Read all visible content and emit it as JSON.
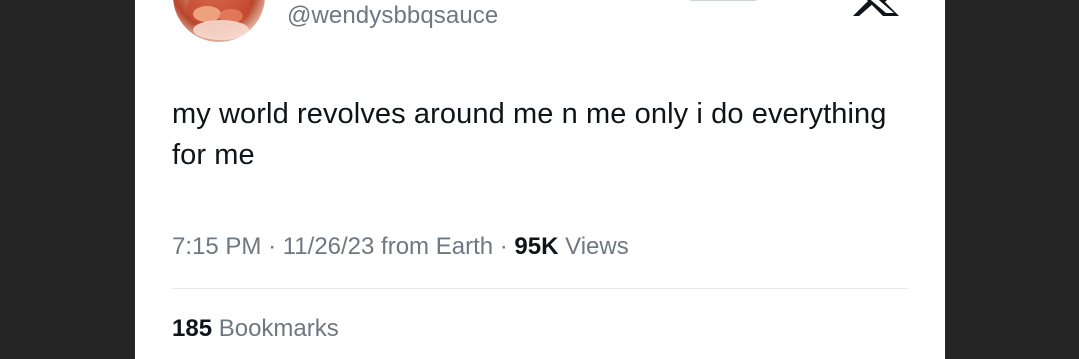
{
  "tweet": {
    "handle": "@wendysbbqsauce",
    "text": "my world revolves around me n me only i do everything for me",
    "time": "7:15 PM",
    "date": "11/26/23",
    "source": "from Earth",
    "separator": "·",
    "views_count": "95K",
    "views_label": "Views",
    "bookmarks_count": "185",
    "bookmarks_label": "Bookmarks"
  },
  "colors": {
    "background": "#252525",
    "card": "#ffffff",
    "text_primary": "#0f1419",
    "text_secondary": "#6f7780",
    "divider": "#e6e9eb"
  },
  "icons": {
    "top_right": "x-logo-icon",
    "avatar": "profile-avatar"
  }
}
